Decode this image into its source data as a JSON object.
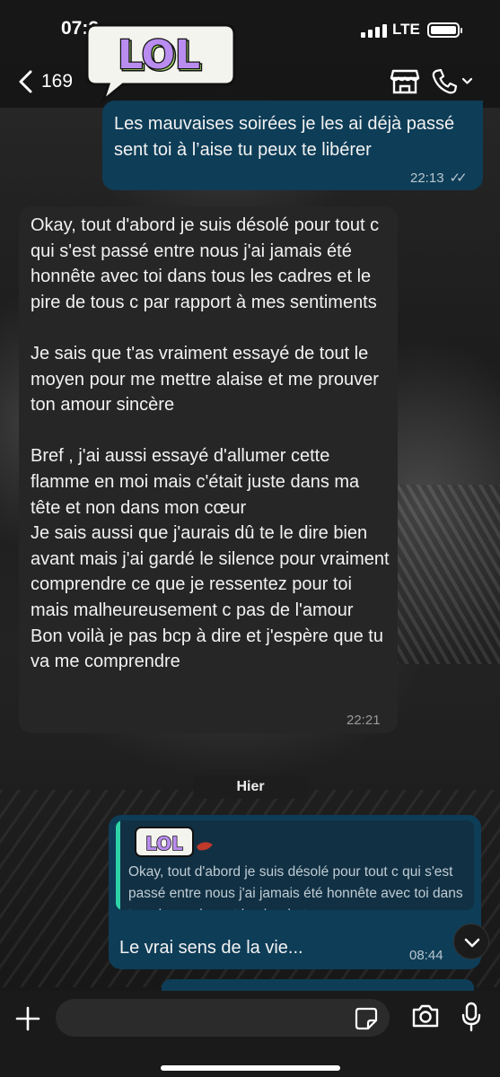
{
  "status_bar": {
    "time": "07:2",
    "network": "LTE"
  },
  "header": {
    "back_count": "169",
    "sticker_text": "LOL",
    "icons": [
      "back-chevron-icon",
      "store-icon",
      "phone-icon",
      "chevron-down-icon"
    ]
  },
  "messages": [
    {
      "direction": "outgoing",
      "text": "Les mauvaises soirées je les ai déjà passé sent toi à l’aise tu peux te libérer",
      "time": "22:13",
      "status": "read"
    },
    {
      "direction": "incoming",
      "text": "Okay, tout d'abord je suis désolé pour tout c qui s'est passé entre nous j'ai jamais été honnête avec toi dans tous les cadres et le pire de tous c par rapport à mes sentiments\n\nJe sais que t'as vraiment essayé de tout le moyen pour me mettre alaise et me prouver ton amour sincère\n\nBref , j'ai aussi essayé d'allumer cette flamme en moi mais c'était juste dans ma tête et non dans mon cœur\nJe sais aussi que j'aurais dû te le dire bien avant mais j'ai gardé le silence pour vraiment comprendre ce que je ressentez pour toi mais malheureusement c pas de l'amour\nBon voilà je pas bcp à dire et j'espère que tu va me comprendre",
      "time": "22:21"
    },
    {
      "direction": "outgoing",
      "quoted_sticker": "LOL",
      "quoted_text": "Okay, tout d'abord je suis désolé pour tout c qui s'est passé entre nous j'ai jamais été honnête avec toi dans tous les cadres et le pire de tous...",
      "text": "Le vrai sens de la vie...",
      "time": "08:44"
    }
  ],
  "day_separator": "Hier",
  "colors": {
    "outgoing_bubble": "#0e3d57",
    "incoming_bubble": "#262626",
    "quote_bar": "#2ed3a8"
  }
}
